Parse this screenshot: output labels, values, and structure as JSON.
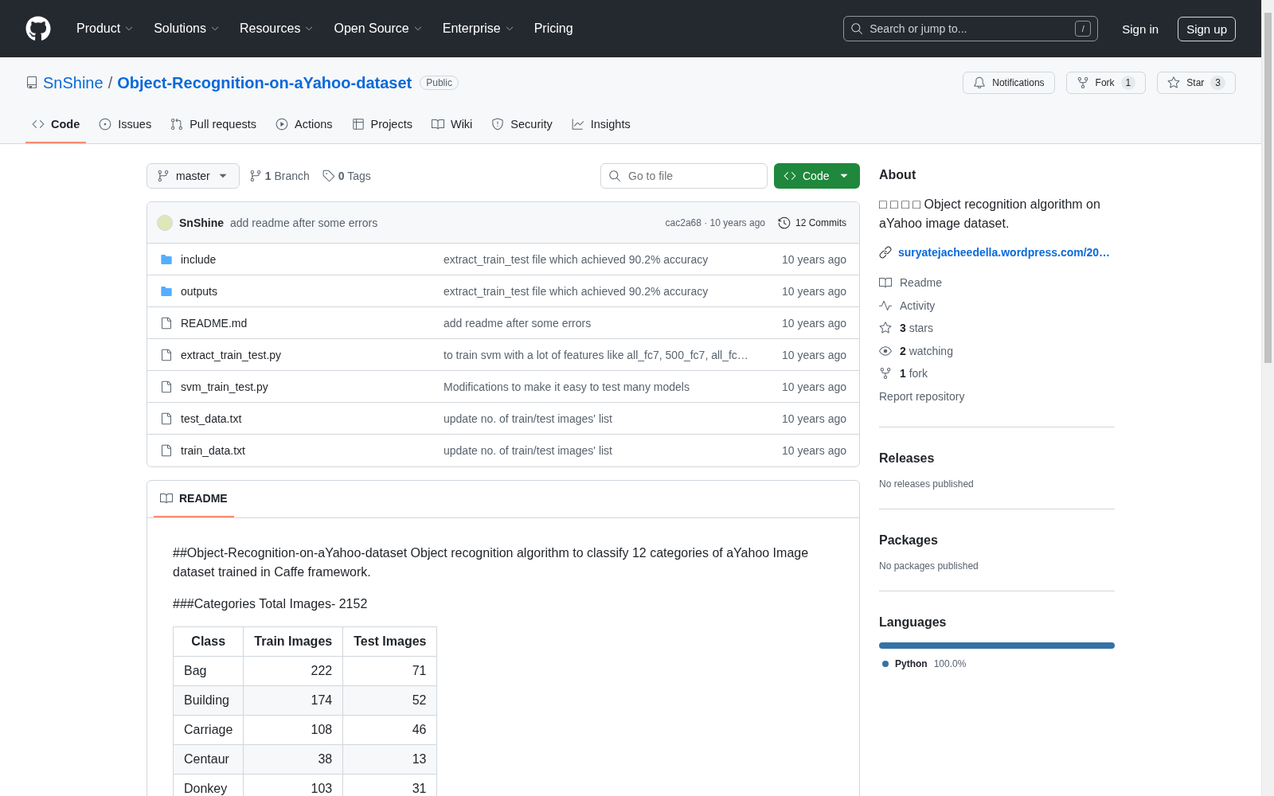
{
  "header": {
    "nav": [
      {
        "label": "Product",
        "has_menu": true
      },
      {
        "label": "Solutions",
        "has_menu": true
      },
      {
        "label": "Resources",
        "has_menu": true
      },
      {
        "label": "Open Source",
        "has_menu": true
      },
      {
        "label": "Enterprise",
        "has_menu": true
      },
      {
        "label": "Pricing",
        "has_menu": false
      }
    ],
    "search": {
      "placeholder": "Search or jump to...",
      "shortcut": "/"
    },
    "sign_in": "Sign in",
    "sign_up": "Sign up"
  },
  "repo": {
    "owner": "SnShine",
    "separator": "/",
    "name": "Object-Recognition-on-aYahoo-dataset",
    "visibility": "Public",
    "notifications": "Notifications",
    "fork": {
      "label": "Fork",
      "count": "1"
    },
    "star": {
      "label": "Star",
      "count": "3"
    }
  },
  "tabs": [
    {
      "label": "Code",
      "selected": true
    },
    {
      "label": "Issues",
      "selected": false
    },
    {
      "label": "Pull requests",
      "selected": false
    },
    {
      "label": "Actions",
      "selected": false
    },
    {
      "label": "Projects",
      "selected": false
    },
    {
      "label": "Wiki",
      "selected": false
    },
    {
      "label": "Security",
      "selected": false
    },
    {
      "label": "Insights",
      "selected": false
    }
  ],
  "toolbar": {
    "branch": "master",
    "branches": "**1** Branch",
    "tags": "**0** Tags",
    "go_to_file": {
      "placeholder": "Go to file"
    },
    "code_button": "Code"
  },
  "commit": {
    "author": "SnShine",
    "message": "add readme after some errors",
    "meta": "cac2a68 · 10 years ago",
    "commits": "12 Commits"
  },
  "files": [
    {
      "kind": "folder",
      "name": "include",
      "message": "extract_train_test file which achieved 90.2% accuracy",
      "time": "10 years ago"
    },
    {
      "kind": "folder",
      "name": "outputs",
      "message": "extract_train_test file which achieved 90.2% accuracy",
      "time": "10 years ago"
    },
    {
      "kind": "file",
      "name": "README.md",
      "message": "add readme after some errors",
      "time": "10 years ago"
    },
    {
      "kind": "file",
      "name": "extract_train_test.py",
      "message": "to train svm with a lot of features like all_fc7, 500_fc7, all_fc…",
      "time": "10 years ago"
    },
    {
      "kind": "file",
      "name": "svm_train_test.py",
      "message": "Modifications to make it easy to test many models",
      "time": "10 years ago"
    },
    {
      "kind": "file",
      "name": "test_data.txt",
      "message": "update no. of train/test images' list",
      "time": "10 years ago"
    },
    {
      "kind": "file",
      "name": "train_data.txt",
      "message": "update no. of train/test images' list",
      "time": "10 years ago"
    }
  ],
  "readme": {
    "tab": "README",
    "paragraphs": [
      "##Object-Recognition-on-aYahoo-dataset Object recognition algorithm to classify 12 categories of aYahoo Image dataset trained in Caffe framework.",
      "###Categories Total Images- 2152"
    ],
    "table": {
      "columns": [
        "Class",
        "Train Images",
        "Test Images"
      ],
      "rows": [
        [
          "Bag",
          "222",
          "71"
        ],
        [
          "Building",
          "174",
          "52"
        ],
        [
          "Carriage",
          "108",
          "46"
        ],
        [
          "Centaur",
          "38",
          "13"
        ],
        [
          "Donkey",
          "103",
          "31"
        ]
      ]
    }
  },
  "sidebar": {
    "about": {
      "heading": "About",
      "description": "□ □ □ □ Object recognition algorithm on aYahoo image dataset.",
      "link": "suryatejacheedella.wordpress.com/20…",
      "stats": [
        {
          "kind": "readme",
          "text": "Readme"
        },
        {
          "kind": "activity",
          "text": "Activity"
        },
        {
          "kind": "stars",
          "text": "**3** stars"
        },
        {
          "kind": "watching",
          "text": "**2** watching"
        },
        {
          "kind": "forks",
          "text": "**1** fork"
        }
      ],
      "report": "Report repository"
    },
    "releases": {
      "heading": "Releases",
      "note": "No releases published"
    },
    "packages": {
      "heading": "Packages",
      "note": "No packages published"
    },
    "languages": {
      "heading": "Languages",
      "items": [
        {
          "name": "Python",
          "percent": "100.0%",
          "level": 1.0,
          "color": "#3572a5"
        }
      ]
    }
  }
}
